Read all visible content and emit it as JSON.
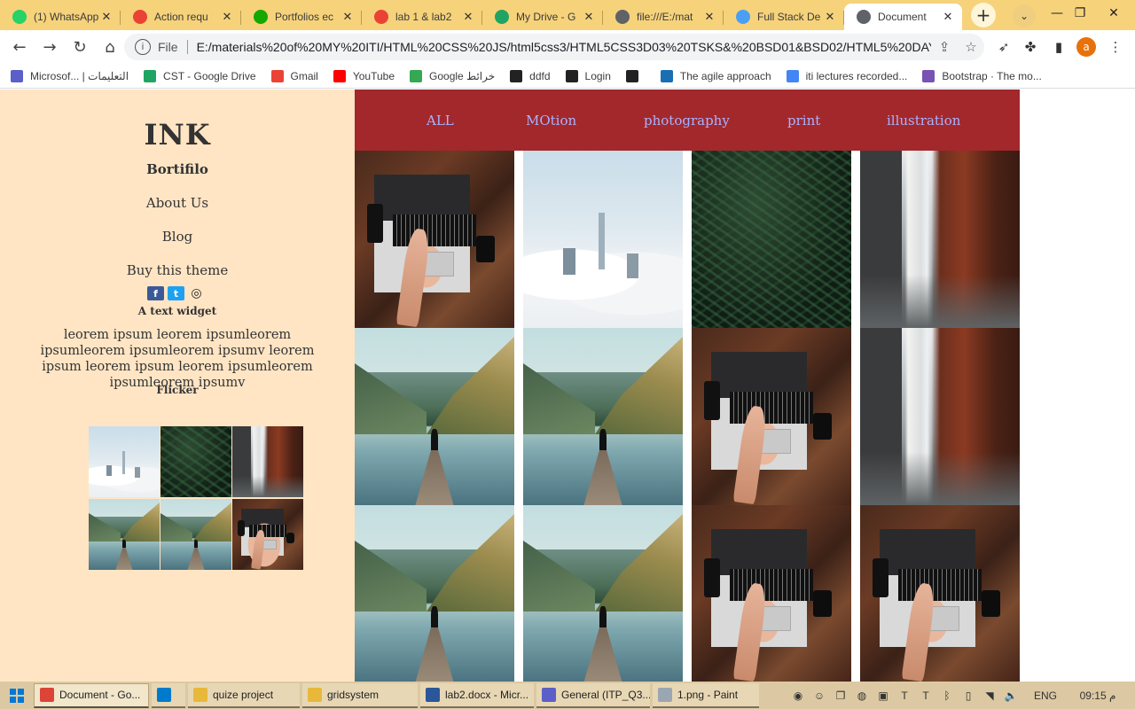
{
  "browser": {
    "tabs": [
      {
        "title": "(1) WhatsApp",
        "icon": "whatsapp-icon",
        "color": "#25d366"
      },
      {
        "title": "Action requ",
        "icon": "gmail-icon",
        "color": "#ea4335"
      },
      {
        "title": "Portfolios ec",
        "icon": "upwork-icon",
        "color": "#14a800"
      },
      {
        "title": "lab 1 & lab2",
        "icon": "gmail-icon",
        "color": "#ea4335"
      },
      {
        "title": "My Drive - G",
        "icon": "google-drive-icon",
        "color": "#1fa463"
      },
      {
        "title": "file:///E:/mat",
        "icon": "globe-icon",
        "color": "#5f6368"
      },
      {
        "title": "Full Stack De",
        "icon": "bootstrap-b-icon",
        "color": "#4a9ff5"
      },
      {
        "title": "Document",
        "icon": "globe-icon",
        "color": "#5f6368"
      }
    ],
    "address": {
      "scheme_label": "File",
      "url": "E:/materials%20of%20MY%20ITI/HTML%20CSS%20JS/html5css3/HTML5CSS3D03%20TSKS&%20BSD01&BSD02/HTML5%20DAY3%2..."
    },
    "profile_initial": "a",
    "bookmarks": [
      {
        "label": "Microsof... | التعليمات",
        "icon": "teams-icon",
        "color": "#5b5fc7"
      },
      {
        "label": "CST - Google Drive",
        "icon": "google-drive-icon",
        "color": "#1fa463"
      },
      {
        "label": "Gmail",
        "icon": "gmail-icon",
        "color": "#ea4335"
      },
      {
        "label": "YouTube",
        "icon": "youtube-icon",
        "color": "#ff0000"
      },
      {
        "label": "Google خرائط",
        "icon": "google-maps-icon",
        "color": "#34a853"
      },
      {
        "label": "ddfd",
        "icon": "globe-icon",
        "color": "#222222"
      },
      {
        "label": "Login",
        "icon": "globe-icon",
        "color": "#222222"
      },
      {
        "label": "",
        "icon": "globe-icon",
        "color": "#222222"
      },
      {
        "label": "The agile approach",
        "icon": "video-icon",
        "color": "#1a6fb3"
      },
      {
        "label": "iti lectures recorded...",
        "icon": "docs-icon",
        "color": "#4285f4"
      },
      {
        "label": "Bootstrap · The mo...",
        "icon": "bootstrap-b-icon",
        "color": "#7952b3"
      }
    ]
  },
  "sidebar": {
    "brand": "INK",
    "subtitle": "Bortifilo",
    "links": [
      "About Us",
      "Blog",
      "Buy this theme"
    ],
    "social": [
      {
        "icon": "facebook-icon",
        "color": "#3b5998"
      },
      {
        "icon": "twitter-icon",
        "color": "#1da1f2"
      },
      {
        "icon": "eye-icon",
        "color": "#222222"
      }
    ],
    "widget_title": "A text widget",
    "widget_text": "leorem ipsum leorem ipsumleorem ipsumleorem ipsumleorem ipsumv leorem ipsum leorem ipsum leorem ipsumleorem ipsumleorem ipsumv",
    "flicker_title": "Flicker",
    "thumbnails": [
      "clouds-city",
      "fern",
      "waterfall",
      "lake-dock",
      "lake-dock",
      "laptop-desk"
    ]
  },
  "main": {
    "nav": [
      "ALL",
      "MOtion",
      "photography",
      "print",
      "illustration"
    ],
    "gallery": [
      "laptop-desk",
      "clouds-city",
      "fern",
      "waterfall",
      "lake-dock",
      "lake-dock",
      "laptop-desk",
      "waterfall",
      "lake-dock",
      "lake-dock",
      "laptop-desk",
      "laptop-desk"
    ]
  },
  "colors": {
    "sidebar_bg": "#ffe5c4",
    "nav_bg": "#a2282c",
    "nav_link": "#a8b2ff"
  },
  "taskbar": {
    "items": [
      {
        "label": "Document - Go...",
        "icon": "chrome-icon",
        "active": true
      },
      {
        "label": "",
        "icon": "vscode-icon",
        "active": false
      },
      {
        "label": "quize project",
        "icon": "folder-icon",
        "active": false
      },
      {
        "label": "gridsystem",
        "icon": "folder-icon",
        "active": false
      },
      {
        "label": "lab2.docx - Micr...",
        "icon": "word-icon",
        "active": false
      },
      {
        "label": "General (ITP_Q3...",
        "icon": "teams-icon",
        "active": false
      },
      {
        "label": "1.png - Paint",
        "icon": "paint-icon",
        "active": false
      }
    ],
    "language": "ENG",
    "time": "09:15 م"
  }
}
